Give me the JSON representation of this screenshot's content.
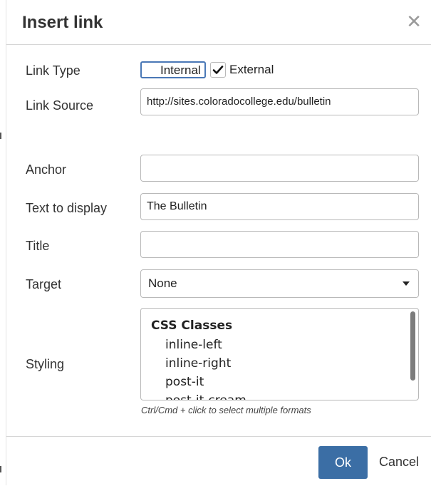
{
  "dialog": {
    "title": "Insert link",
    "close_icon": "close-icon"
  },
  "fields": {
    "link_type": {
      "label": "Link Type",
      "options": [
        {
          "label": "Internal",
          "checked": false
        },
        {
          "label": "External",
          "checked": true
        }
      ]
    },
    "link_source": {
      "label": "Link Source",
      "value": "http://sites.coloradocollege.edu/bulletin"
    },
    "anchor": {
      "label": "Anchor",
      "value": ""
    },
    "text_to_display": {
      "label": "Text to display",
      "value": "The Bulletin"
    },
    "title": {
      "label": "Title",
      "value": ""
    },
    "target": {
      "label": "Target",
      "value": "None"
    },
    "styling": {
      "label": "Styling",
      "group_header": "CSS Classes",
      "items": [
        "inline-left",
        "inline-right",
        "post-it",
        "post-it-cream"
      ],
      "hint": "Ctrl/Cmd + click to select multiple formats"
    }
  },
  "buttons": {
    "ok": "Ok",
    "cancel": "Cancel"
  },
  "colors": {
    "accent": "#3b6ea5",
    "focus_border": "#4a78b6"
  }
}
